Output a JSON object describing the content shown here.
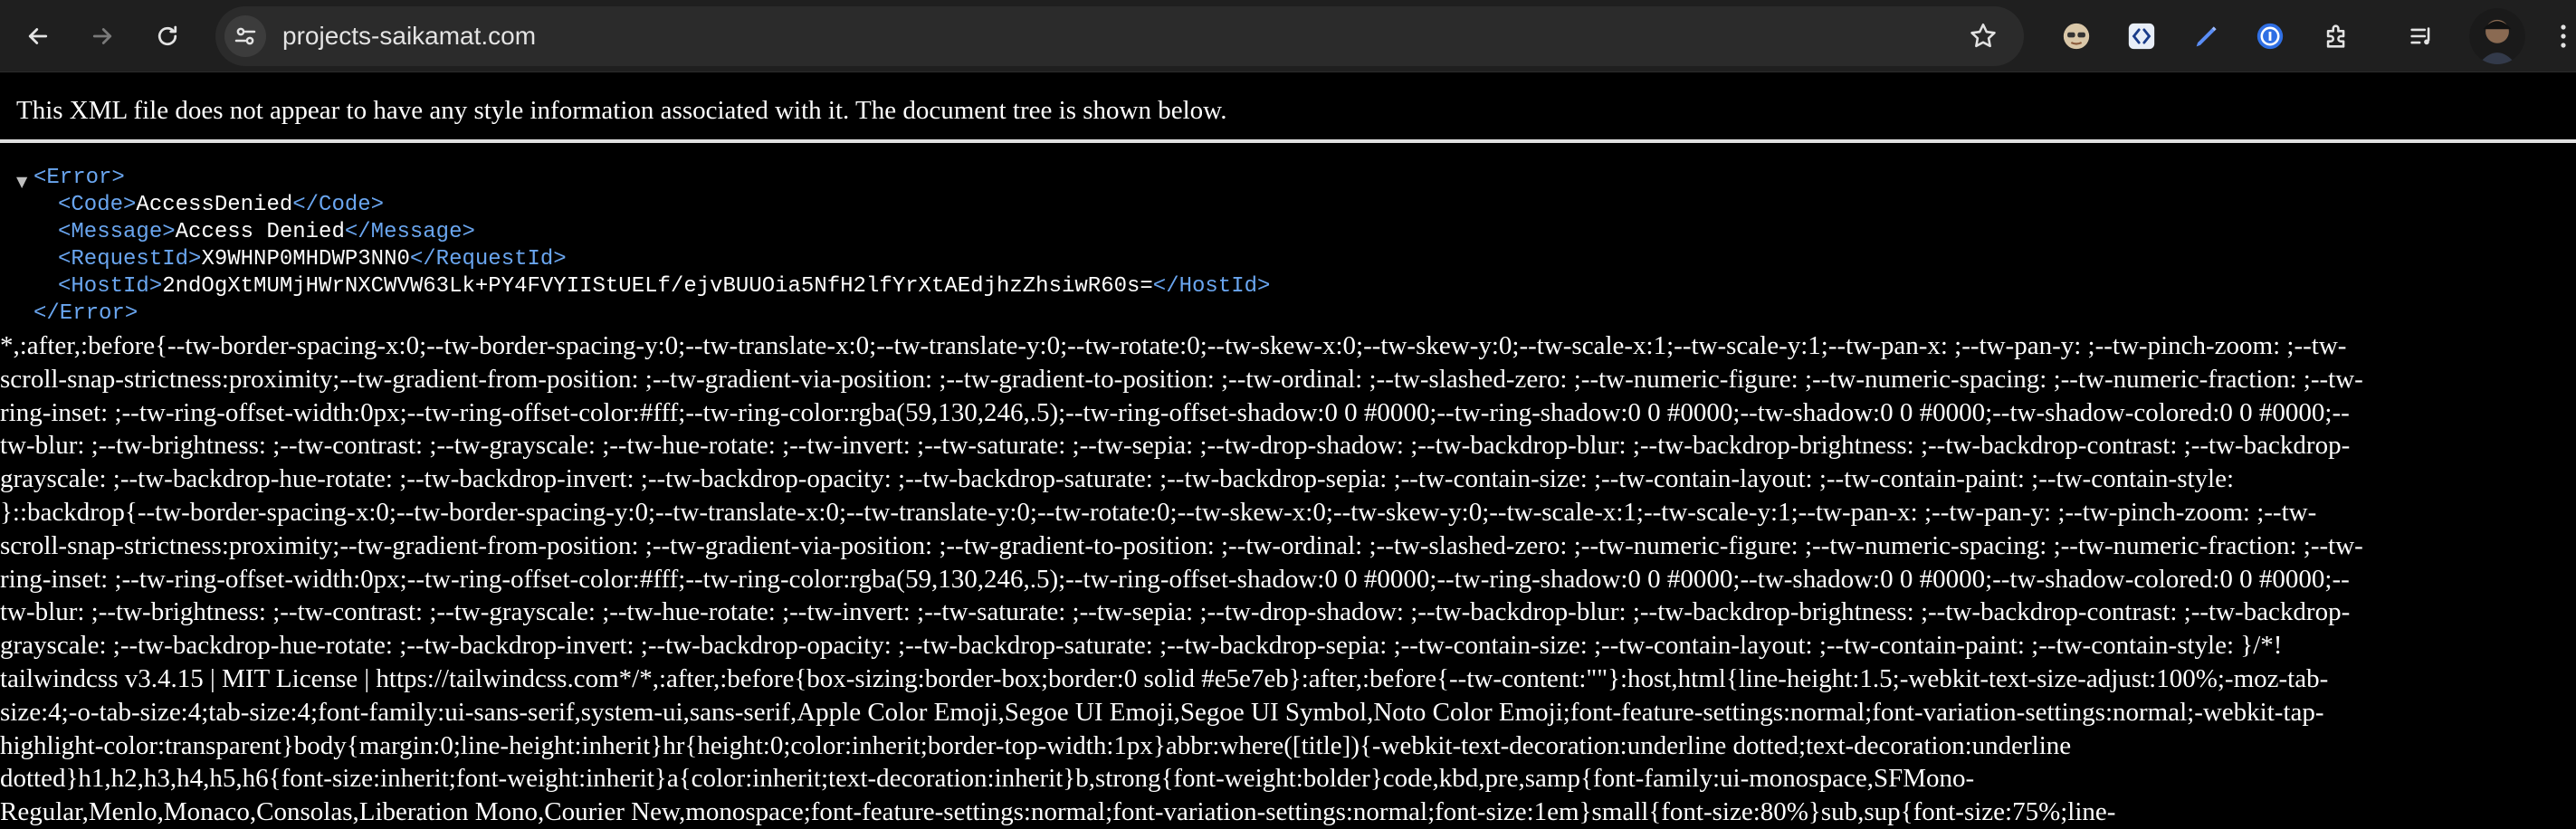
{
  "browser": {
    "url": "projects-saikamat.com",
    "nav": {
      "back_icon": "arrow-left-icon",
      "forward_icon": "arrow-right-icon",
      "reload_icon": "reload-icon"
    },
    "extensions": [
      "avatar-extension-icon",
      "bracket-extension-icon",
      "pen-extension-icon",
      "password-manager-icon",
      "puzzle-extensions-icon",
      "media-queue-icon"
    ]
  },
  "page": {
    "xml_notice": "This XML file does not appear to have any style information associated with it. The document tree is shown below.",
    "xml": {
      "toggle": "▼",
      "error_open": "<Error>",
      "error_close": "</Error>",
      "code_open": "<Code>",
      "code_value": "AccessDenied",
      "code_close": "</Code>",
      "message_open": "<Message>",
      "message_value": "Access Denied",
      "message_close": "</Message>",
      "requestid_open": "<RequestId>",
      "requestid_value": "X9WHNP0MHDWP3NN0",
      "requestid_close": "</RequestId>",
      "hostid_open": "<HostId>",
      "hostid_value": "2ndOgXtMUMjHWrNXCWVW63Lk+PY4FVYIIStUELf/ejvBUUOia5NfH2lfYrXtAEdjhzZhsiwR60s=",
      "hostid_close": "</HostId>"
    },
    "css_lines": [
      "*,:after,:before{--tw-border-spacing-x:0;--tw-border-spacing-y:0;--tw-translate-x:0;--tw-translate-y:0;--tw-rotate:0;--tw-skew-x:0;--tw-skew-y:0;--tw-scale-x:1;--tw-scale-y:1;--tw-pan-x: ;--tw-pan-y: ;--tw-pinch-zoom: ;--tw-",
      "scroll-snap-strictness:proximity;--tw-gradient-from-position: ;--tw-gradient-via-position: ;--tw-gradient-to-position: ;--tw-ordinal: ;--tw-slashed-zero: ;--tw-numeric-figure: ;--tw-numeric-spacing: ;--tw-numeric-fraction: ;--tw-",
      "ring-inset: ;--tw-ring-offset-width:0px;--tw-ring-offset-color:#fff;--tw-ring-color:rgba(59,130,246,.5);--tw-ring-offset-shadow:0 0 #0000;--tw-ring-shadow:0 0 #0000;--tw-shadow:0 0 #0000;--tw-shadow-colored:0 0 #0000;--",
      "tw-blur: ;--tw-brightness: ;--tw-contrast: ;--tw-grayscale: ;--tw-hue-rotate: ;--tw-invert: ;--tw-saturate: ;--tw-sepia: ;--tw-drop-shadow: ;--tw-backdrop-blur: ;--tw-backdrop-brightness: ;--tw-backdrop-contrast: ;--tw-backdrop-",
      "grayscale: ;--tw-backdrop-hue-rotate: ;--tw-backdrop-invert: ;--tw-backdrop-opacity: ;--tw-backdrop-saturate: ;--tw-backdrop-sepia: ;--tw-contain-size: ;--tw-contain-layout: ;--tw-contain-paint: ;--tw-contain-style:",
      "}::backdrop{--tw-border-spacing-x:0;--tw-border-spacing-y:0;--tw-translate-x:0;--tw-translate-y:0;--tw-rotate:0;--tw-skew-x:0;--tw-skew-y:0;--tw-scale-x:1;--tw-scale-y:1;--tw-pan-x: ;--tw-pan-y: ;--tw-pinch-zoom: ;--tw-",
      "scroll-snap-strictness:proximity;--tw-gradient-from-position: ;--tw-gradient-via-position: ;--tw-gradient-to-position: ;--tw-ordinal: ;--tw-slashed-zero: ;--tw-numeric-figure: ;--tw-numeric-spacing: ;--tw-numeric-fraction: ;--tw-",
      "ring-inset: ;--tw-ring-offset-width:0px;--tw-ring-offset-color:#fff;--tw-ring-color:rgba(59,130,246,.5);--tw-ring-offset-shadow:0 0 #0000;--tw-ring-shadow:0 0 #0000;--tw-shadow:0 0 #0000;--tw-shadow-colored:0 0 #0000;--",
      "tw-blur: ;--tw-brightness: ;--tw-contrast: ;--tw-grayscale: ;--tw-hue-rotate: ;--tw-invert: ;--tw-saturate: ;--tw-sepia: ;--tw-drop-shadow: ;--tw-backdrop-blur: ;--tw-backdrop-brightness: ;--tw-backdrop-contrast: ;--tw-backdrop-",
      "grayscale: ;--tw-backdrop-hue-rotate: ;--tw-backdrop-invert: ;--tw-backdrop-opacity: ;--tw-backdrop-saturate: ;--tw-backdrop-sepia: ;--tw-contain-size: ;--tw-contain-layout: ;--tw-contain-paint: ;--tw-contain-style: }/*!",
      "tailwindcss v3.4.15 | MIT License | https://tailwindcss.com*/*,:after,:before{box-sizing:border-box;border:0 solid #e5e7eb}:after,:before{--tw-content:\"\"}:host,html{line-height:1.5;-webkit-text-size-adjust:100%;-moz-tab-",
      "size:4;-o-tab-size:4;tab-size:4;font-family:ui-sans-serif,system-ui,sans-serif,Apple Color Emoji,Segoe UI Emoji,Segoe UI Symbol,Noto Color Emoji;font-feature-settings:normal;font-variation-settings:normal;-webkit-tap-",
      "highlight-color:transparent}body{margin:0;line-height:inherit}hr{height:0;color:inherit;border-top-width:1px}abbr:where([title]){-webkit-text-decoration:underline dotted;text-decoration:underline",
      "dotted}h1,h2,h3,h4,h5,h6{font-size:inherit;font-weight:inherit}a{color:inherit;text-decoration:inherit}b,strong{font-weight:bolder}code,kbd,pre,samp{font-family:ui-monospace,SFMono-",
      "Regular,Menlo,Monaco,Consolas,Liberation Mono,Courier New,monospace;font-feature-settings:normal;font-variation-settings:normal;font-size:1em}small{font-size:80%}sub,sup{font-size:75%;line-"
    ]
  },
  "colors": {
    "chrome_bg": "#1f1f1f",
    "omnibox_bg": "#2b2b2b",
    "page_bg": "#000000",
    "xml_tag": "#6aa6f0",
    "text": "#ffffff"
  }
}
